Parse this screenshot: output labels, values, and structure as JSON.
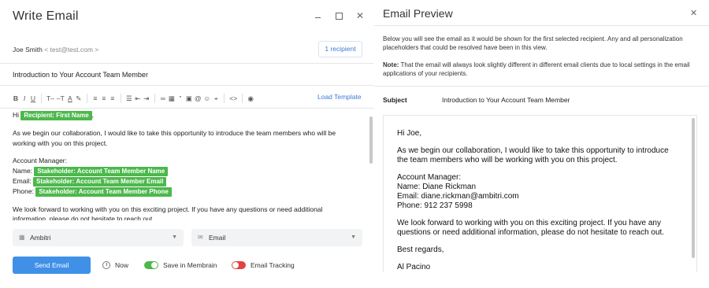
{
  "compose": {
    "title": "Write Email",
    "sender_name": "Joe Smith",
    "sender_email": "< test@test.com >",
    "recipient_button": "1 recipient",
    "subject": "Introduction to Your Account Team Member",
    "toolbar": {
      "bold": "B",
      "italic": "I",
      "underline": "U",
      "font_size": "T‒",
      "font_size_2": "‒T",
      "font_color": "A",
      "eraser": "✎",
      "align_left": "≡",
      "align_center": "≡",
      "align_right": "≡",
      "list_bullets": "☰",
      "indent_less": "⇤",
      "indent_more": "⇥",
      "link": "∞",
      "calendar": "▦",
      "quote": "”",
      "image": "▣",
      "mention": "@",
      "emoji": "☺",
      "attach": "⌖",
      "code": "<>",
      "preview": "◉"
    },
    "load_template": "Load Template",
    "body": {
      "greeting_prefix": "Hi",
      "greeting_tag": "Recipient: First Name",
      "greeting_suffix": ",",
      "para1_line1": "As we begin our collaboration, I would like to take this opportunity to introduce the team members who will be",
      "para1_line2": "working with you on this project.",
      "manager_heading": "Account Manager:",
      "name_label": "Name:",
      "name_tag": "Stakeholder: Account Team Member Name",
      "email_label": "Email:",
      "email_tag": "Stakeholder: Account Team Member Email",
      "phone_label": "Phone:",
      "phone_tag": "Stakeholder: Account Team Member Phone",
      "para2_line1": "We look forward to working with you on this exciting project. If you have any questions or need additional",
      "para2_line2": "information, please do not hesitate to reach out."
    },
    "company_select": "Ambitri",
    "channel_select": "Email",
    "send_button": "Send Email",
    "now_label": "Now",
    "save_label": "Save in Membrain",
    "tracking_label": "Email Tracking",
    "save_toggle_on": true,
    "tracking_toggle_on": false
  },
  "preview": {
    "title": "Email Preview",
    "description": "Below you will see the email as it would be shown for the first selected recipient. Any and all personalization placeholders that could be resolved have been in this view.",
    "note_label": "Note:",
    "note_text": " That the email will always look slightly different in different email clients due to local settings in the email applications of your recipients.",
    "subject_label": "Subject",
    "subject_value": "Introduction to Your Account Team Member",
    "body": {
      "greeting": "Hi Joe,",
      "para1_line1": "As we begin our collaboration, I would like to take this opportunity to introduce",
      "para1_line2": "the team members who will be working with you on this project.",
      "manager_heading": "Account Manager:",
      "name_line": "Name: Diane Rickman",
      "email_line": "Email: diane.rickman@ambitri.com",
      "phone_line": "Phone: 912 237 5998",
      "para2_line1": "We look forward to working with you on this exciting project. If you have any",
      "para2_line2": "questions or need additional information, please do not hesitate to reach out.",
      "closing": "Best regards,",
      "signature": "Al Pacino"
    }
  },
  "colors": {
    "accent_blue": "#3f90e6",
    "link_blue": "#3a7bd5",
    "tag_green": "#4cb84c",
    "toggle_off_red": "#e0443c"
  }
}
